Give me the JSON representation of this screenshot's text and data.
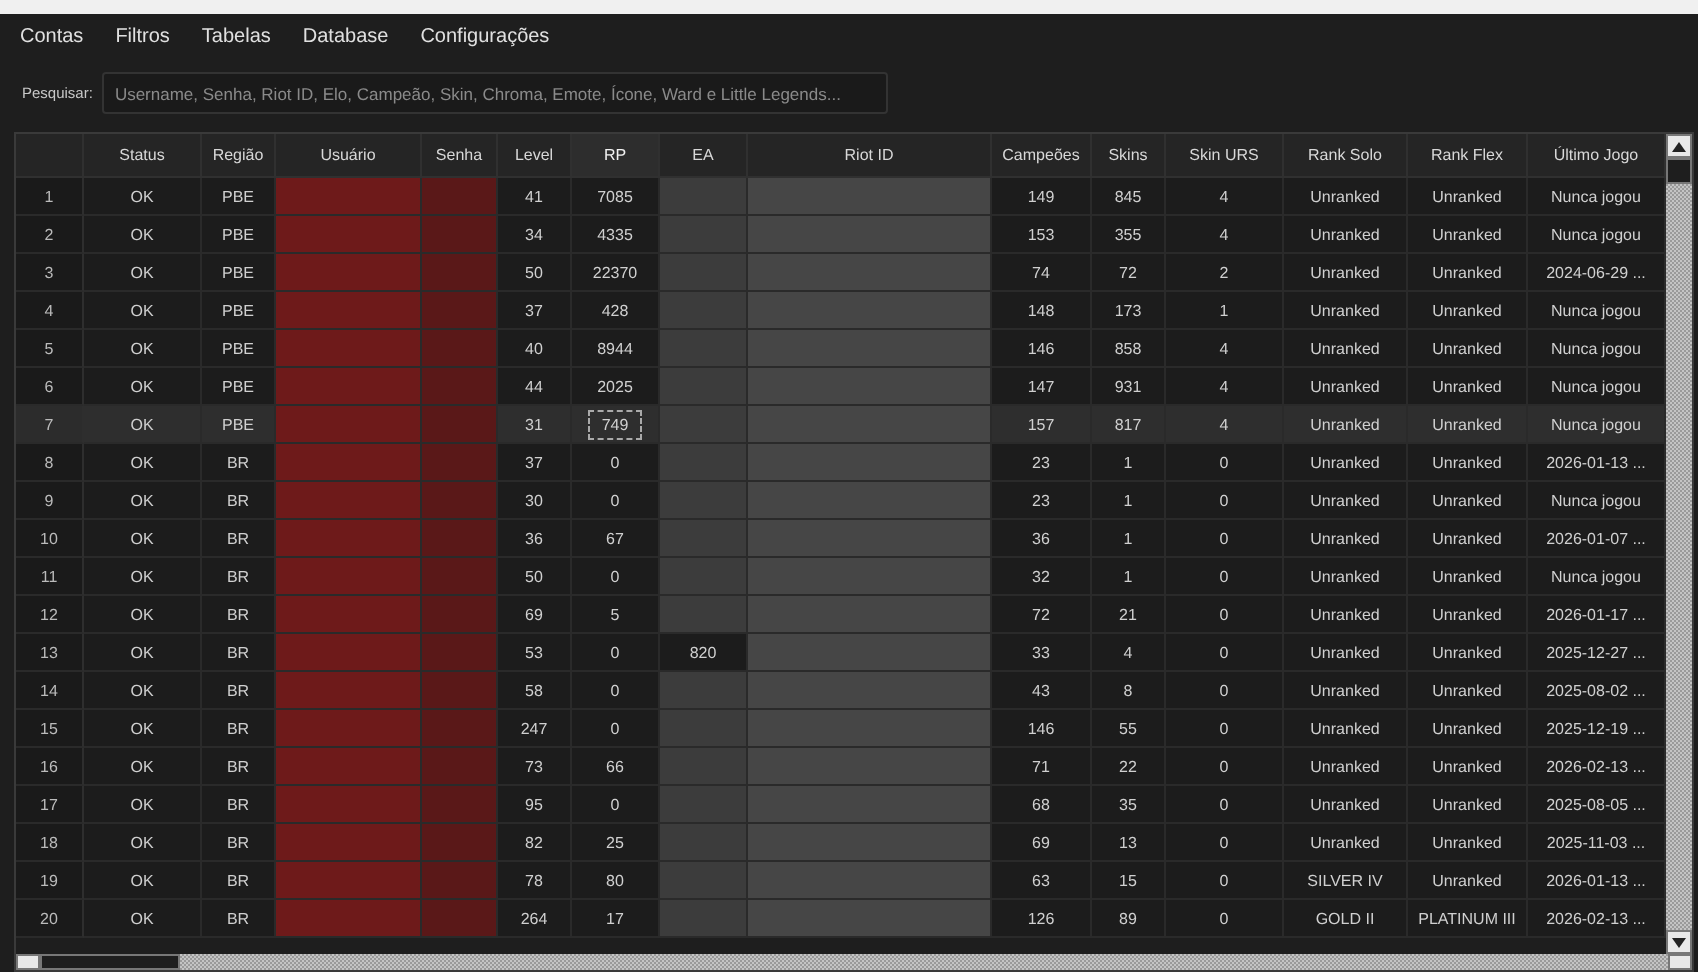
{
  "menu": [
    {
      "label": "Contas"
    },
    {
      "label": "Filtros"
    },
    {
      "label": "Tabelas"
    },
    {
      "label": "Database"
    },
    {
      "label": "Configurações"
    }
  ],
  "search": {
    "label": "Pesquisar:",
    "placeholder": "Username, Senha, Riot ID, Elo, Campeão, Skin, Chroma, Emote, Ícone, Ward e Little Legends..."
  },
  "table": {
    "columns": [
      {
        "label": "Status",
        "kind": "text",
        "focused": false
      },
      {
        "label": "Região",
        "kind": "text",
        "focused": false
      },
      {
        "label": "Usuário",
        "kind": "redacted",
        "color": "#6e1a1a",
        "focused": false
      },
      {
        "label": "Senha",
        "kind": "redacted",
        "color": "#5a1818",
        "focused": false
      },
      {
        "label": "Level",
        "kind": "text",
        "focused": false
      },
      {
        "label": "RP",
        "kind": "text",
        "focused": true
      },
      {
        "label": "EA",
        "kind": "redacted",
        "color": "#3c3c3c",
        "focused": false
      },
      {
        "label": "Riot ID",
        "kind": "redacted",
        "color": "#464646",
        "focused": false
      },
      {
        "label": "Campeões",
        "kind": "text",
        "focused": false
      },
      {
        "label": "Skins",
        "kind": "text",
        "focused": false
      },
      {
        "label": "Skin URS",
        "kind": "text",
        "focused": false
      },
      {
        "label": "Rank Solo",
        "kind": "text",
        "focused": false
      },
      {
        "label": "Rank Flex",
        "kind": "text",
        "focused": false
      },
      {
        "label": "Último Jogo",
        "kind": "text",
        "focused": false
      }
    ],
    "rows": [
      {
        "number": "1",
        "selected": false,
        "focused": false,
        "cells": [
          "OK",
          "PBE",
          null,
          null,
          "41",
          "7085",
          null,
          null,
          "149",
          "845",
          "4",
          "Unranked",
          "Unranked",
          "Nunca jogou"
        ]
      },
      {
        "number": "2",
        "selected": false,
        "focused": false,
        "cells": [
          "OK",
          "PBE",
          null,
          null,
          "34",
          "4335",
          null,
          null,
          "153",
          "355",
          "4",
          "Unranked",
          "Unranked",
          "Nunca jogou"
        ]
      },
      {
        "number": "3",
        "selected": false,
        "focused": false,
        "cells": [
          "OK",
          "PBE",
          null,
          null,
          "50",
          "22370",
          null,
          null,
          "74",
          "72",
          "2",
          "Unranked",
          "Unranked",
          "2024-06-29 ..."
        ]
      },
      {
        "number": "4",
        "selected": false,
        "focused": false,
        "cells": [
          "OK",
          "PBE",
          null,
          null,
          "37",
          "428",
          null,
          null,
          "148",
          "173",
          "1",
          "Unranked",
          "Unranked",
          "Nunca jogou"
        ]
      },
      {
        "number": "5",
        "selected": false,
        "focused": false,
        "cells": [
          "OK",
          "PBE",
          null,
          null,
          "40",
          "8944",
          null,
          null,
          "146",
          "858",
          "4",
          "Unranked",
          "Unranked",
          "Nunca jogou"
        ]
      },
      {
        "number": "6",
        "selected": false,
        "focused": false,
        "cells": [
          "OK",
          "PBE",
          null,
          null,
          "44",
          "2025",
          null,
          null,
          "147",
          "931",
          "4",
          "Unranked",
          "Unranked",
          "Nunca jogou"
        ]
      },
      {
        "number": "7",
        "selected": true,
        "focused": true,
        "cells": [
          "OK",
          "PBE",
          null,
          null,
          "31",
          "749",
          null,
          null,
          "157",
          "817",
          "4",
          "Unranked",
          "Unranked",
          "Nunca jogou"
        ]
      },
      {
        "number": "8",
        "selected": false,
        "focused": false,
        "cells": [
          "OK",
          "BR",
          null,
          null,
          "37",
          "0",
          null,
          null,
          "23",
          "1",
          "0",
          "Unranked",
          "Unranked",
          "2026-01-13 ..."
        ]
      },
      {
        "number": "9",
        "selected": false,
        "focused": false,
        "cells": [
          "OK",
          "BR",
          null,
          null,
          "30",
          "0",
          null,
          null,
          "23",
          "1",
          "0",
          "Unranked",
          "Unranked",
          "Nunca jogou"
        ]
      },
      {
        "number": "10",
        "selected": false,
        "focused": false,
        "cells": [
          "OK",
          "BR",
          null,
          null,
          "36",
          "67",
          null,
          null,
          "36",
          "1",
          "0",
          "Unranked",
          "Unranked",
          "2026-01-07 ..."
        ]
      },
      {
        "number": "11",
        "selected": false,
        "focused": false,
        "cells": [
          "OK",
          "BR",
          null,
          null,
          "50",
          "0",
          null,
          null,
          "32",
          "1",
          "0",
          "Unranked",
          "Unranked",
          "Nunca jogou"
        ]
      },
      {
        "number": "12",
        "selected": false,
        "focused": false,
        "cells": [
          "OK",
          "BR",
          null,
          null,
          "69",
          "5",
          null,
          null,
          "72",
          "21",
          "0",
          "Unranked",
          "Unranked",
          "2026-01-17 ..."
        ]
      },
      {
        "number": "13",
        "selected": false,
        "focused": false,
        "cells": [
          "OK",
          "BR",
          null,
          null,
          "53",
          "0",
          "820",
          null,
          "33",
          "4",
          "0",
          "Unranked",
          "Unranked",
          "2025-12-27 ..."
        ]
      },
      {
        "number": "14",
        "selected": false,
        "focused": false,
        "cells": [
          "OK",
          "BR",
          null,
          null,
          "58",
          "0",
          null,
          null,
          "43",
          "8",
          "0",
          "Unranked",
          "Unranked",
          "2025-08-02 ..."
        ]
      },
      {
        "number": "15",
        "selected": false,
        "focused": false,
        "cells": [
          "OK",
          "BR",
          null,
          null,
          "247",
          "0",
          null,
          null,
          "146",
          "55",
          "0",
          "Unranked",
          "Unranked",
          "2025-12-19 ..."
        ]
      },
      {
        "number": "16",
        "selected": false,
        "focused": false,
        "cells": [
          "OK",
          "BR",
          null,
          null,
          "73",
          "66",
          null,
          null,
          "71",
          "22",
          "0",
          "Unranked",
          "Unranked",
          "2026-02-13 ..."
        ]
      },
      {
        "number": "17",
        "selected": false,
        "focused": false,
        "cells": [
          "OK",
          "BR",
          null,
          null,
          "95",
          "0",
          null,
          null,
          "68",
          "35",
          "0",
          "Unranked",
          "Unranked",
          "2025-08-05 ..."
        ]
      },
      {
        "number": "18",
        "selected": false,
        "focused": false,
        "cells": [
          "OK",
          "BR",
          null,
          null,
          "82",
          "25",
          null,
          null,
          "69",
          "13",
          "0",
          "Unranked",
          "Unranked",
          "2025-11-03 ..."
        ]
      },
      {
        "number": "19",
        "selected": false,
        "focused": false,
        "cells": [
          "OK",
          "BR",
          null,
          null,
          "78",
          "80",
          null,
          null,
          "63",
          "15",
          "0",
          "SILVER IV",
          "Unranked",
          "2026-01-13 ..."
        ]
      },
      {
        "number": "20",
        "selected": false,
        "focused": false,
        "cells": [
          "OK",
          "BR",
          null,
          null,
          "264",
          "17",
          null,
          null,
          "126",
          "89",
          "0",
          "GOLD II",
          "PLATINUM III",
          "2026-02-13 ..."
        ]
      }
    ]
  }
}
